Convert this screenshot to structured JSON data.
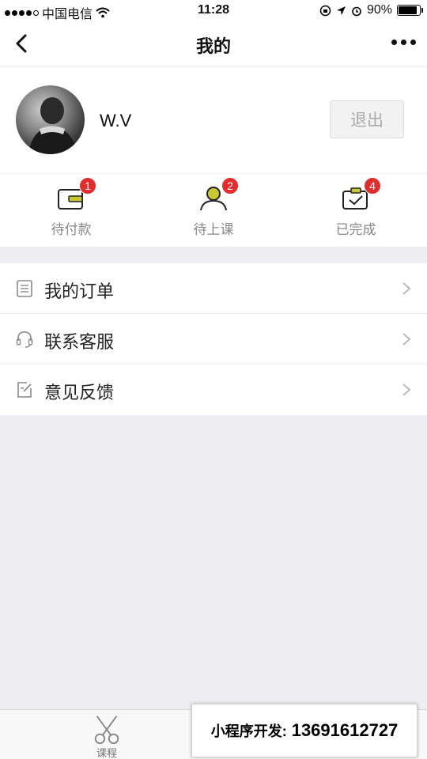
{
  "status_bar": {
    "carrier": "中国电信",
    "time": "11:28",
    "battery": "90%",
    "battery_level": 0.9
  },
  "nav": {
    "title": "我的"
  },
  "profile": {
    "username": "W.V",
    "logout_label": "退出"
  },
  "order_status": [
    {
      "label": "待付款",
      "count": "1",
      "icon": "wallet-icon"
    },
    {
      "label": "待上课",
      "count": "2",
      "icon": "person-icon"
    },
    {
      "label": "已完成",
      "count": "4",
      "icon": "done-icon"
    }
  ],
  "menu": [
    {
      "label": "我的订单",
      "icon": "list-icon"
    },
    {
      "label": "联系客服",
      "icon": "headset-icon"
    },
    {
      "label": "意见反馈",
      "icon": "feedback-icon"
    }
  ],
  "tabbar": {
    "course_label": "课程"
  },
  "promo": {
    "label": "小程序开发:",
    "phone": "13691612727"
  },
  "colors": {
    "badge": "#e32d2d",
    "accent": "#c8c832",
    "background": "#eeeef2"
  }
}
